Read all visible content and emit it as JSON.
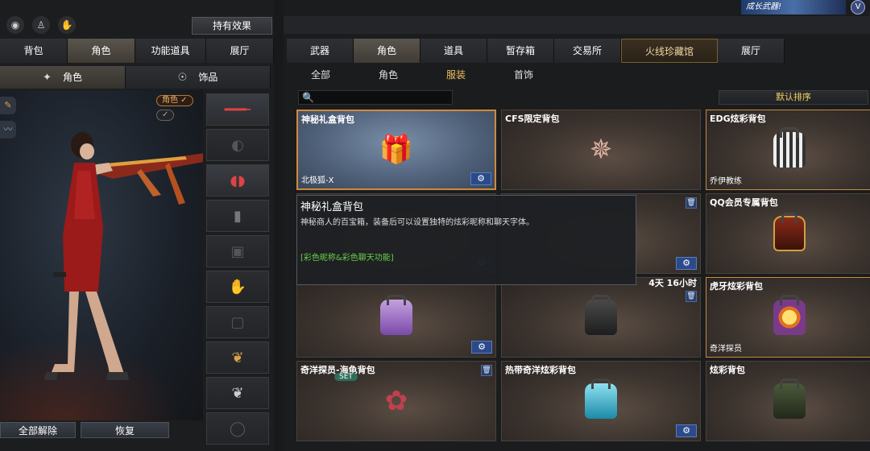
{
  "top": {
    "effect_button": "持有效果",
    "banner_text": "成长武器!",
    "crest_glyph": "V"
  },
  "left_tabs": [
    "背包",
    "角色",
    "功能道具",
    "展厅"
  ],
  "left_sub_tabs": [
    "角色",
    "饰品"
  ],
  "character_tags": {
    "role": "角色 ✓",
    "other": "✓"
  },
  "bottom_buttons": {
    "unequip_all": "全部解除",
    "restore": "恢复"
  },
  "main_tabs": [
    "武器",
    "角色",
    "道具",
    "暂存箱",
    "交易所",
    "火线珍藏馆",
    "展厅"
  ],
  "category_tabs": [
    "全部",
    "角色",
    "服装",
    "首饰"
  ],
  "search": {
    "placeholder": "",
    "icon": "search-icon"
  },
  "sort_label": "默认排序",
  "items": [
    {
      "title": "神秘礼盒背包",
      "sub": "北极狐-X"
    },
    {
      "title": "CFS限定背包",
      "sub": ""
    },
    {
      "title": "EDG炫彩背包",
      "sub": "乔伊教练"
    },
    {
      "title": "",
      "sub": ""
    },
    {
      "title": "",
      "sub": ""
    },
    {
      "title": "QQ会员专属背包",
      "sub": ""
    },
    {
      "title": "",
      "sub": ""
    },
    {
      "title": "",
      "sub": "",
      "timer": "4天 16小时"
    },
    {
      "title": "虎牙炫彩背包",
      "sub": "奇洋探员"
    },
    {
      "title": "奇洋探员-海龟背包",
      "sub": "",
      "badge": "SET"
    },
    {
      "title": "热带奇洋炫彩背包",
      "sub": ""
    },
    {
      "title": "炫彩背包",
      "sub": ""
    }
  ],
  "tooltip": {
    "title": "神秘礼盒背包",
    "description": "神秘商人的百宝箱，装备后可以设置独特的炫彩昵称和聊天字体。",
    "feature": "[彩色昵称&彩色聊天功能]"
  },
  "colors": {
    "accent": "#f0c060",
    "selected_border": "#d08a3a",
    "feature_green": "#6ad04a"
  }
}
